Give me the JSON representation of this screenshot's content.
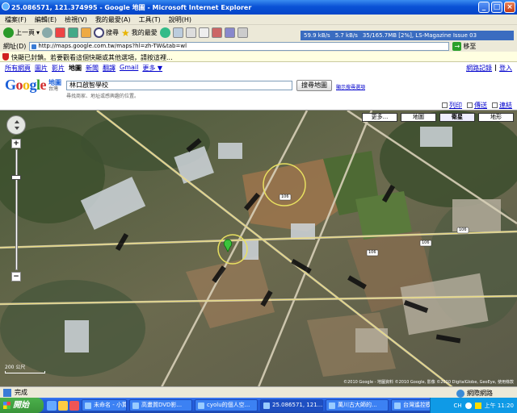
{
  "window": {
    "title": "25.086571, 121.374995 - Google 地圖 - Microsoft Internet Explorer"
  },
  "menu": [
    "檔案(F)",
    "編輯(E)",
    "檢視(V)",
    "我的最愛(A)",
    "工具(T)",
    "說明(H)"
  ],
  "toolbar": {
    "back": "上一頁",
    "search": "搜尋",
    "favorites": "我的最愛"
  },
  "netstats": {
    "down": "59.9 kB/s",
    "up": "5.7 kB/s",
    "progress": "35/165.7MB [2%], LS-Magazine Issue 03"
  },
  "address": {
    "label": "網址(D)",
    "url": "http://maps.google.com.tw/maps?hl=zh-TW&tab=wl",
    "go": "移至"
  },
  "infobar": {
    "text": "快顯已封鎖。若要觀看這個快顯或其他選項，請按這裡..."
  },
  "google_nav": {
    "items": [
      "所有網頁",
      "圖片",
      "影片",
      "地圖",
      "新聞",
      "翻譯",
      "Gmail"
    ],
    "active": "地圖",
    "more": "更多 ▼"
  },
  "signin": {
    "history": "網路記錄",
    "separator": "|",
    "login": "登入"
  },
  "logo": {
    "text": "Google",
    "tag": "地圖",
    "region": "台灣"
  },
  "search": {
    "value": "林口啟智學校",
    "hint": "尋找商家、地址或感興趣的位置。",
    "button": "搜尋地圖",
    "options": "顯示搜尋選項"
  },
  "map_links": {
    "print": "列印",
    "send": "傳送",
    "link": "連結"
  },
  "map_types": {
    "more": "更多...",
    "map": "地圖",
    "satellite": "衛星",
    "terrain": "地形"
  },
  "map_labels": [
    "106",
    "106",
    "106",
    "106"
  ],
  "scale": {
    "label": "200 公尺"
  },
  "copyright": "©2010 Google - 地圖資料 ©2010 Google, 影像 ©2010 DigitalGlobe, GeoEye, 使用條款",
  "status": {
    "text": "完成",
    "zone": "網際網路"
  },
  "taskbar": {
    "start": "開始",
    "tasks": [
      "未命名 - 小算盤",
      "高畫質DVD影...",
      "cyolu的個人空...",
      "25.086571, 121...",
      "萬川古大師的...",
      "台灣遙控模型..."
    ],
    "active_index": 3,
    "tray_lang": "CH",
    "clock": "上午 11:20"
  }
}
